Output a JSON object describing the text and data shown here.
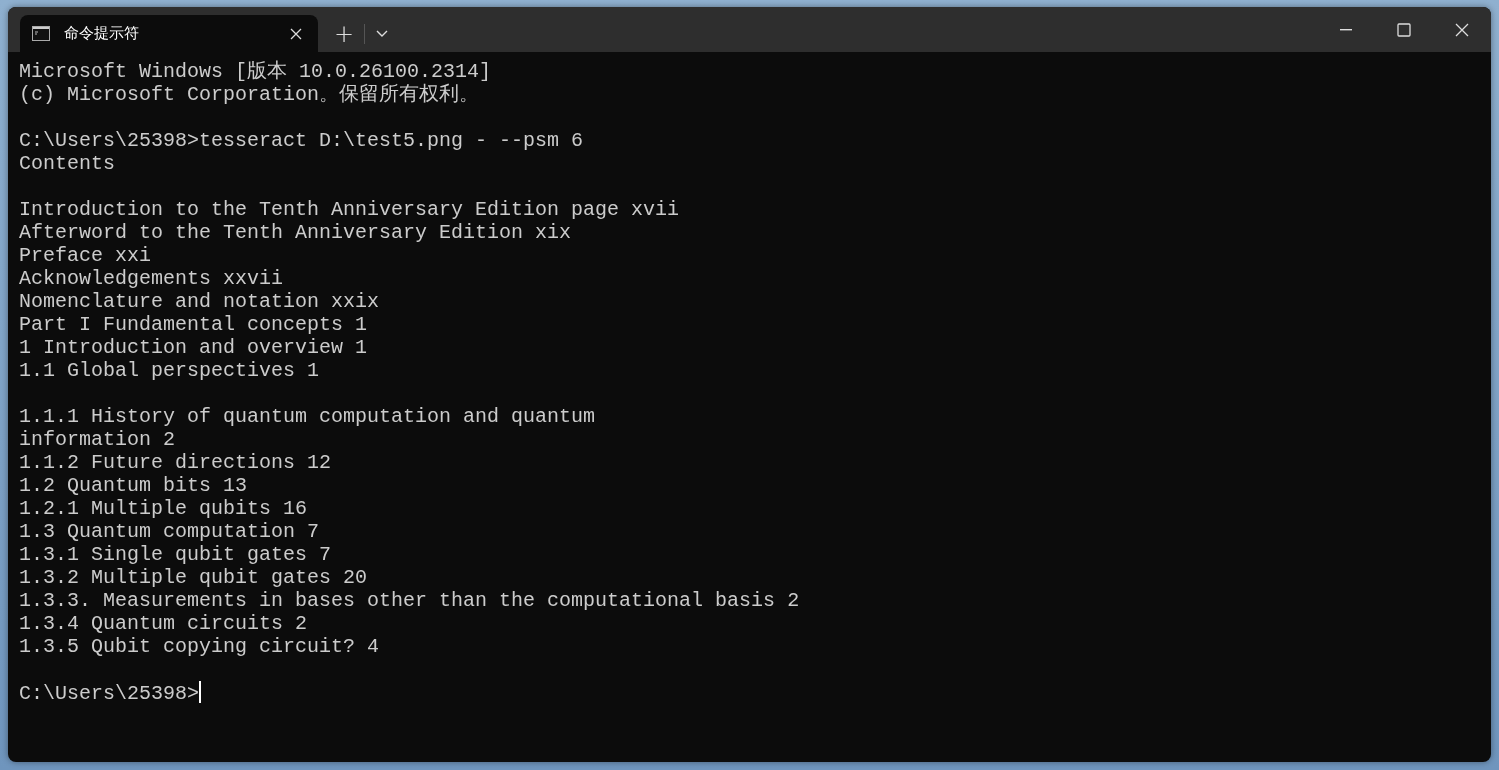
{
  "window": {
    "tab": {
      "title": "命令提示符",
      "selected": true
    },
    "new_tab": "+"
  },
  "terminal": {
    "blocks": [
      [
        "Microsoft Windows [版本 10.0.26100.2314]",
        "(c) Microsoft Corporation。保留所有权利。"
      ],
      [
        "C:\\Users\\25398>tesseract D:\\test5.png - --psm 6",
        "Contents"
      ],
      [
        "Introduction to the Tenth Anniversary Edition page xvii",
        "Afterword to the Tenth Anniversary Edition xix",
        "Preface xxi",
        "Acknowledgements xxvii",
        "Nomenclature and notation xxix",
        "Part I Fundamental concepts 1",
        "1 Introduction and overview 1",
        "1.1 Global perspectives 1"
      ],
      [
        "1.1.1 History of quantum computation and quantum",
        "information 2",
        "1.1.2 Future directions 12",
        "1.2 Quantum bits 13",
        "1.2.1 Multiple qubits 16",
        "1.3 Quantum computation 7",
        "1.3.1 Single qubit gates 7",
        "1.3.2 Multiple qubit gates 20",
        "1.3.3. Measurements in bases other than the computational basis 2",
        "1.3.4 Quantum circuits 2",
        "1.3.5 Qubit copying circuit? 4"
      ]
    ],
    "prompt": "C:\\Users\\25398>",
    "cursor": true
  }
}
